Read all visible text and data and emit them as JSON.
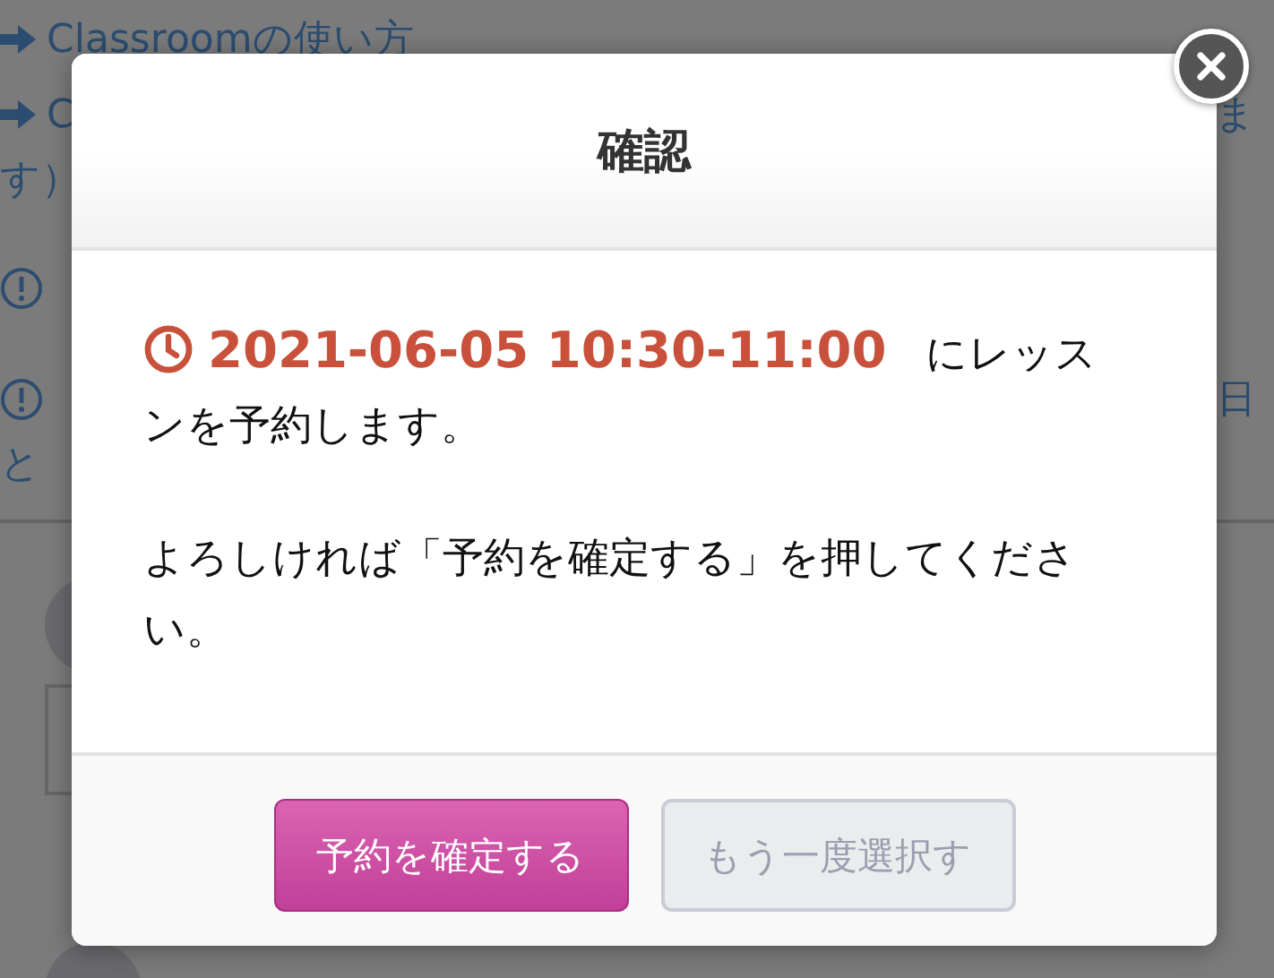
{
  "background": {
    "links": [
      {
        "text": "Classroomの使い方"
      },
      {
        "text": "C",
        "tail": "ま"
      }
    ],
    "link_wrap": "す）",
    "notices": [
      {
        "kind": "warning"
      },
      {
        "kind": "warning",
        "tail": "日",
        "wrap": "と"
      }
    ]
  },
  "modal": {
    "title": "確認",
    "datetime": "2021-06-05 10:30-11:00",
    "message": "にレッスンを予約します。",
    "note": "よろしければ「予約を確定する」を押してください。",
    "buttons": [
      {
        "label": "予約を確定する",
        "kind": "primary"
      },
      {
        "label": "もう一度選択す",
        "kind": "secondary"
      }
    ]
  }
}
